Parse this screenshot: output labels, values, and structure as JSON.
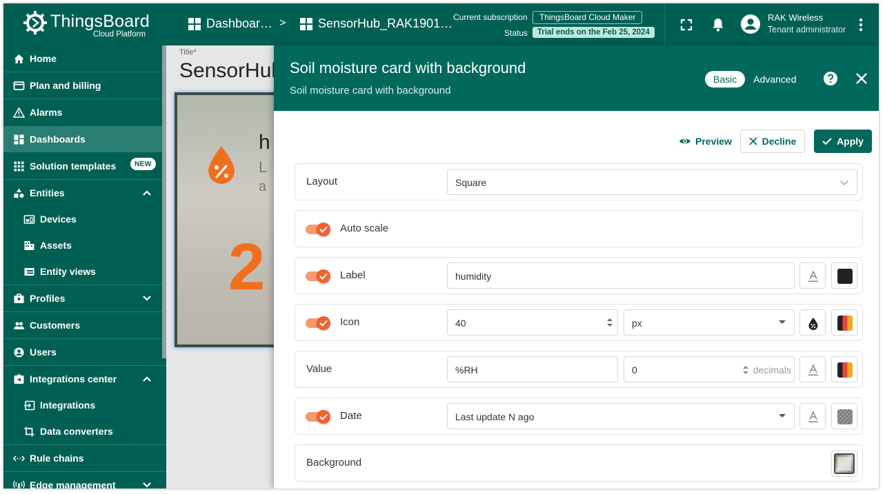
{
  "brand": {
    "name": "ThingsBoard",
    "subtitle": "Cloud Platform"
  },
  "breadcrumb": {
    "dashboards": "Dashboar…",
    "separator": ">",
    "current": "SensorHub_RAK1901…"
  },
  "subscription": {
    "current_label": "Current subscription",
    "plan": "ThingsBoard Cloud Maker",
    "status_label": "Status",
    "status": "Trial ends on the Feb 25, 2024"
  },
  "user": {
    "name": "RAK Wireless",
    "role": "Tenant administrator"
  },
  "sidebar": {
    "items": [
      {
        "label": "Home",
        "icon": "home-icon"
      },
      {
        "label": "Plan and billing",
        "icon": "billing-icon"
      },
      {
        "label": "Alarms",
        "icon": "warning-icon"
      },
      {
        "label": "Dashboards",
        "icon": "dashboard-icon",
        "active": true
      },
      {
        "label": "Solution templates",
        "icon": "apps-icon",
        "badge": "NEW"
      },
      {
        "label": "Entities",
        "icon": "entities-icon",
        "expanded": true
      },
      {
        "label": "Devices",
        "icon": "devices-icon"
      },
      {
        "label": "Assets",
        "icon": "assets-icon"
      },
      {
        "label": "Entity views",
        "icon": "entity-views-icon"
      },
      {
        "label": "Profiles",
        "icon": "profiles-icon",
        "expanded": false
      },
      {
        "label": "Customers",
        "icon": "customers-icon"
      },
      {
        "label": "Users",
        "icon": "users-icon"
      },
      {
        "label": "Integrations center",
        "icon": "integrations-center-icon",
        "expanded": true
      },
      {
        "label": "Integrations",
        "icon": "integrations-icon"
      },
      {
        "label": "Data converters",
        "icon": "data-converters-icon"
      },
      {
        "label": "Rule chains",
        "icon": "rule-chains-icon"
      },
      {
        "label": "Edge management",
        "icon": "edge-icon",
        "expanded": false
      }
    ]
  },
  "dashboard": {
    "title_label": "Title*",
    "title": "SensorHub",
    "preview_value": "2",
    "preview_h": "h",
    "preview_l": "L",
    "preview_a": "a"
  },
  "panel": {
    "title": "Soil moisture card with background",
    "subtitle": "Soil moisture card with background",
    "mode_basic": "Basic",
    "mode_advanced": "Advanced",
    "preview_button": "Preview",
    "decline_button": "Decline",
    "apply_button": "Apply",
    "rows": {
      "layout": {
        "label": "Layout",
        "value": "Square"
      },
      "auto_scale": {
        "label": "Auto scale",
        "enabled": true
      },
      "label": {
        "label": "Label",
        "value": "humidity",
        "enabled": true,
        "color": "#222222"
      },
      "icon": {
        "label": "Icon",
        "size": "40",
        "unit": "px",
        "enabled": true
      },
      "value": {
        "label": "Value",
        "units": "%RH",
        "decimals": "0",
        "decimals_suffix": "decimals"
      },
      "date": {
        "label": "Date",
        "format": "Last update N ago",
        "enabled": true
      },
      "background": {
        "label": "Background"
      }
    }
  },
  "colors": {
    "primary": "#005f53",
    "panel_header": "#00695c",
    "accent": "#f0622e"
  }
}
